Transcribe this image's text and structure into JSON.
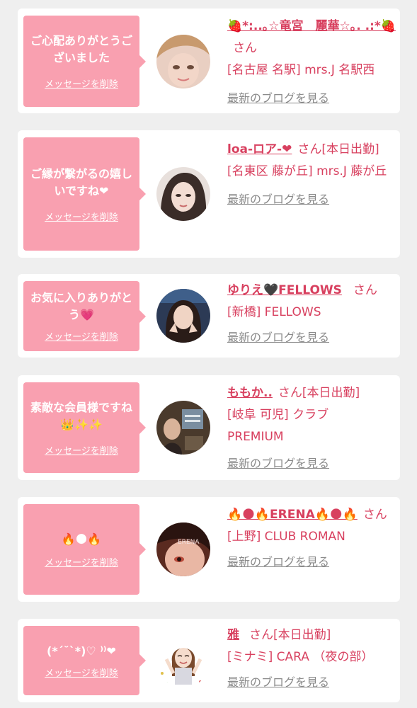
{
  "cards": [
    {
      "message": "ご心配ありがとうございました",
      "delete_label": "メッセージを削除",
      "name": "🍓*:..｡☆竜宮　麗華☆｡. .:*🍓",
      "honorific": "さん",
      "status": "",
      "shop": "[名古屋 名駅] mrs.J 名駅西",
      "blog_label": "最新のブログを見る"
    },
    {
      "message": "ご縁が繋がるの嬉しいですね❤",
      "delete_label": "メッセージを削除",
      "name": "loa-ロア-❤",
      "honorific": "さん",
      "status": "[本日出勤]",
      "shop": "[名東区 藤が丘] mrs.J 藤が丘",
      "blog_label": "最新のブログを見る"
    },
    {
      "message": "お気に入りありがとう💗",
      "delete_label": "メッセージを削除",
      "name": "ゆりえ🖤FELLOWS",
      "honorific": "さん",
      "status": "",
      "shop": "[新橋] FELLOWS",
      "blog_label": "最新のブログを見る"
    },
    {
      "message": "素敵な会員様ですね👑✨✨",
      "delete_label": "メッセージを削除",
      "name": "ももか..",
      "honorific": "さん",
      "status": "[本日出勤]",
      "shop": "[岐阜 可児] クラブPREMIUM",
      "blog_label": "最新のブログを見る"
    },
    {
      "message": "🔥🌑🔥",
      "delete_label": "メッセージを削除",
      "name": "🔥🌑🔥ERENA🔥🌑🔥",
      "honorific": "さん",
      "status": "",
      "shop": "[上野] CLUB ROMAN",
      "blog_label": "最新のブログを見る"
    },
    {
      "message": "(*´˘`*)♡ ⁾⁾❤",
      "delete_label": "メッセージを削除",
      "name": "雅",
      "honorific": "さん",
      "status": "[本日出勤]",
      "shop": "[ミナミ] CARA （夜の部）",
      "blog_label": "最新のブログを見る"
    }
  ],
  "colors": {
    "bubble": "#f9a0b0",
    "accent": "#d8405f",
    "muted": "#8a8a8a",
    "background": "#efefef"
  }
}
